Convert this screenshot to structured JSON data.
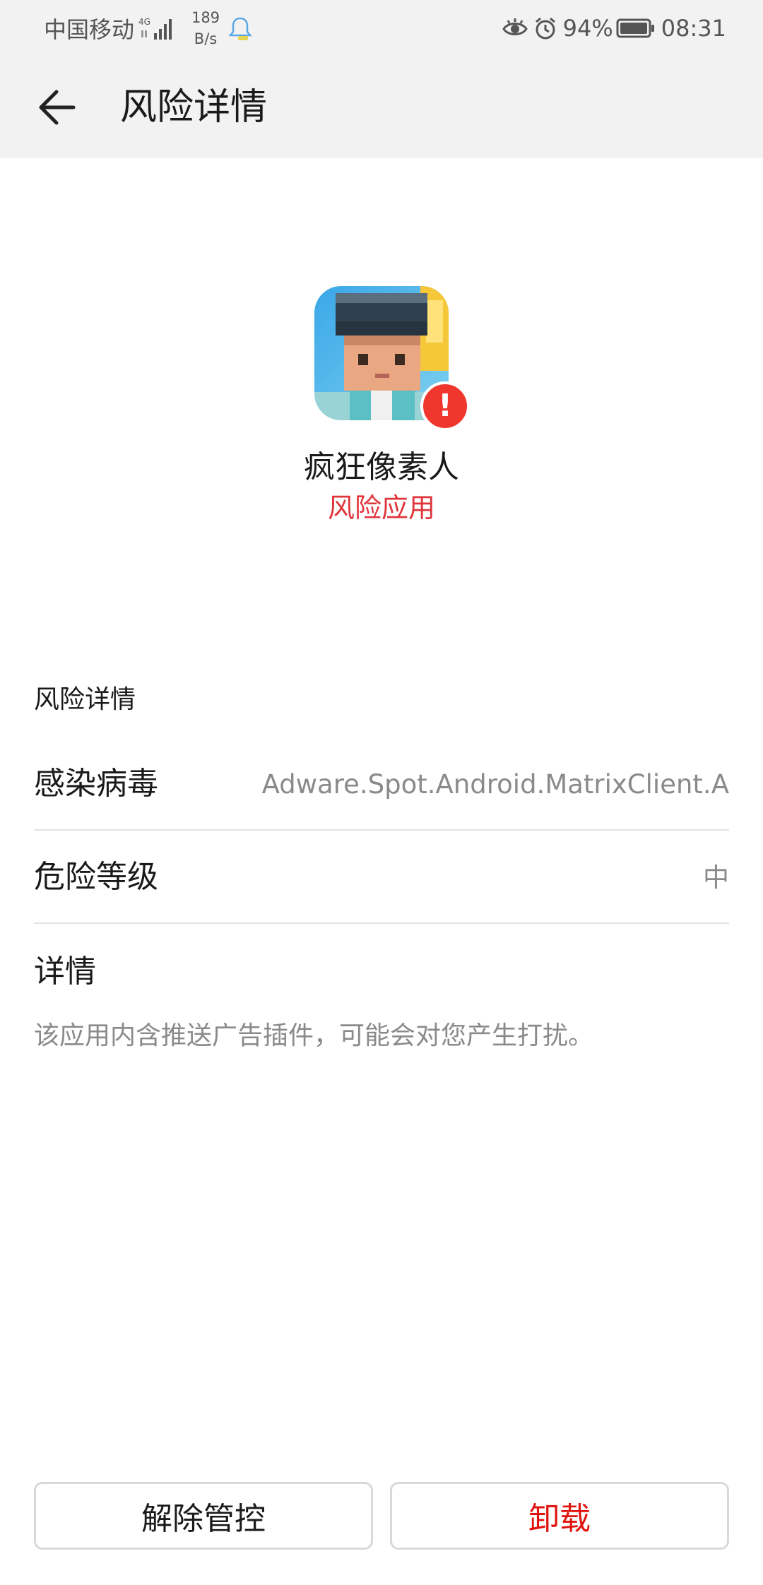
{
  "status_bar": {
    "carrier": "中国移动",
    "network": "4G",
    "speed_value": "189",
    "speed_unit": "B/s",
    "battery": "94%",
    "time": "08:31",
    "icons": [
      "signal-icon",
      "notification-bell-icon",
      "eye-comfort-icon",
      "alarm-icon",
      "battery-icon"
    ]
  },
  "appbar": {
    "title": "风险详情",
    "back_icon": "back-arrow-icon"
  },
  "app": {
    "name": "疯狂像素人",
    "status": "风险应用",
    "badge_icon": "warning-icon"
  },
  "risk": {
    "section_title": "风险详情",
    "rows": [
      {
        "label": "感染病毒",
        "value": "Adware.Spot.Android.MatrixClient.A"
      },
      {
        "label": "危险等级",
        "value": "中"
      }
    ],
    "detail_label": "详情",
    "detail_text": "该应用内含推送广告插件，可能会对您产生打扰。"
  },
  "actions": {
    "release": "解除管控",
    "uninstall": "卸载"
  },
  "colors": {
    "header_bg": "#f2f2f2",
    "risk_red": "#e0353b",
    "uninstall_red": "#e0140f",
    "badge_red": "#f0372e"
  }
}
